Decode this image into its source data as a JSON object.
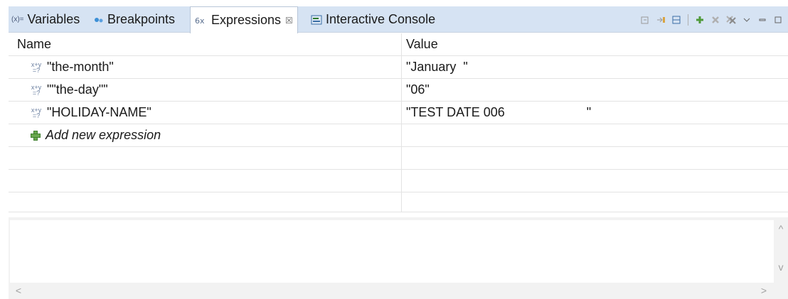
{
  "tabs": [
    {
      "label": "Variables",
      "icon": "variables-icon",
      "icon_text": "(x)="
    },
    {
      "label": "Breakpoints",
      "icon": "breakpoints-icon"
    },
    {
      "label": "Expressions",
      "icon": "expressions-icon",
      "close": "☒",
      "active": true
    },
    {
      "label": "Interactive Console",
      "icon": "console-icon"
    }
  ],
  "table": {
    "headers": {
      "name": "Name",
      "value": "Value"
    },
    "rows": [
      {
        "name": "\"the-month\"",
        "value": "\"January  \""
      },
      {
        "name": "\"\"the-day\"\"",
        "value": "\"06\""
      },
      {
        "name": "\"HOLIDAY-NAME\"",
        "value": "\"TEST DATE 006                       \""
      }
    ],
    "add_label": "Add new expression"
  },
  "icons": {
    "expr_top": "x+y",
    "expr_bottom": "=?"
  },
  "scroll": {
    "up": "^",
    "down": "v",
    "left": "<",
    "right": ">"
  }
}
